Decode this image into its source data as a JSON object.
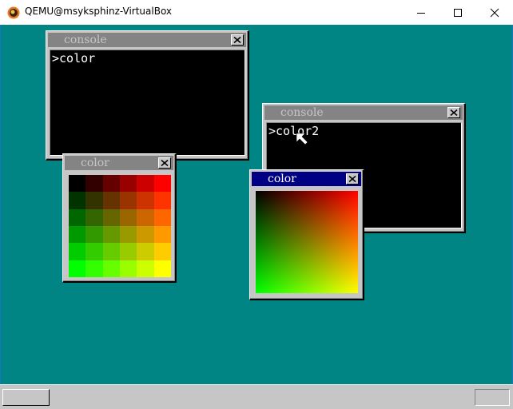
{
  "host": {
    "title": "QEMU@msyksphinz-VirtualBox",
    "controls": [
      "minimize-icon",
      "maximize-icon",
      "close-icon"
    ]
  },
  "windows": {
    "console1": {
      "title": "console",
      "line": ">color",
      "active": false
    },
    "console2": {
      "title": "console",
      "line": ">color2",
      "active": false
    },
    "color1": {
      "title": "color",
      "active": false,
      "palette": [
        [
          "#000000",
          "#330000",
          "#660000",
          "#990000",
          "#cc0000",
          "#ff0000"
        ],
        [
          "#003300",
          "#333300",
          "#663300",
          "#993300",
          "#cc3300",
          "#ff3300"
        ],
        [
          "#006600",
          "#336600",
          "#666600",
          "#996600",
          "#cc6600",
          "#ff6600"
        ],
        [
          "#009900",
          "#339900",
          "#669900",
          "#999900",
          "#cc9900",
          "#ff9900"
        ],
        [
          "#00cc00",
          "#33cc00",
          "#66cc00",
          "#99cc00",
          "#cccc00",
          "#ffcc00"
        ],
        [
          "#00ff00",
          "#33ff00",
          "#66ff00",
          "#99ff00",
          "#ccff00",
          "#ffff00"
        ]
      ]
    },
    "color2": {
      "title": "color",
      "active": true,
      "gradient": {
        "top_left": "#000000",
        "top_right": "#ff0000",
        "bottom_left": "#00ff00",
        "bottom_right": "#ffff00"
      }
    }
  },
  "colors": {
    "desktop": "#008484",
    "window_face": "#c6c6c6",
    "inactive_title": "#848484",
    "active_title": "#000084"
  }
}
